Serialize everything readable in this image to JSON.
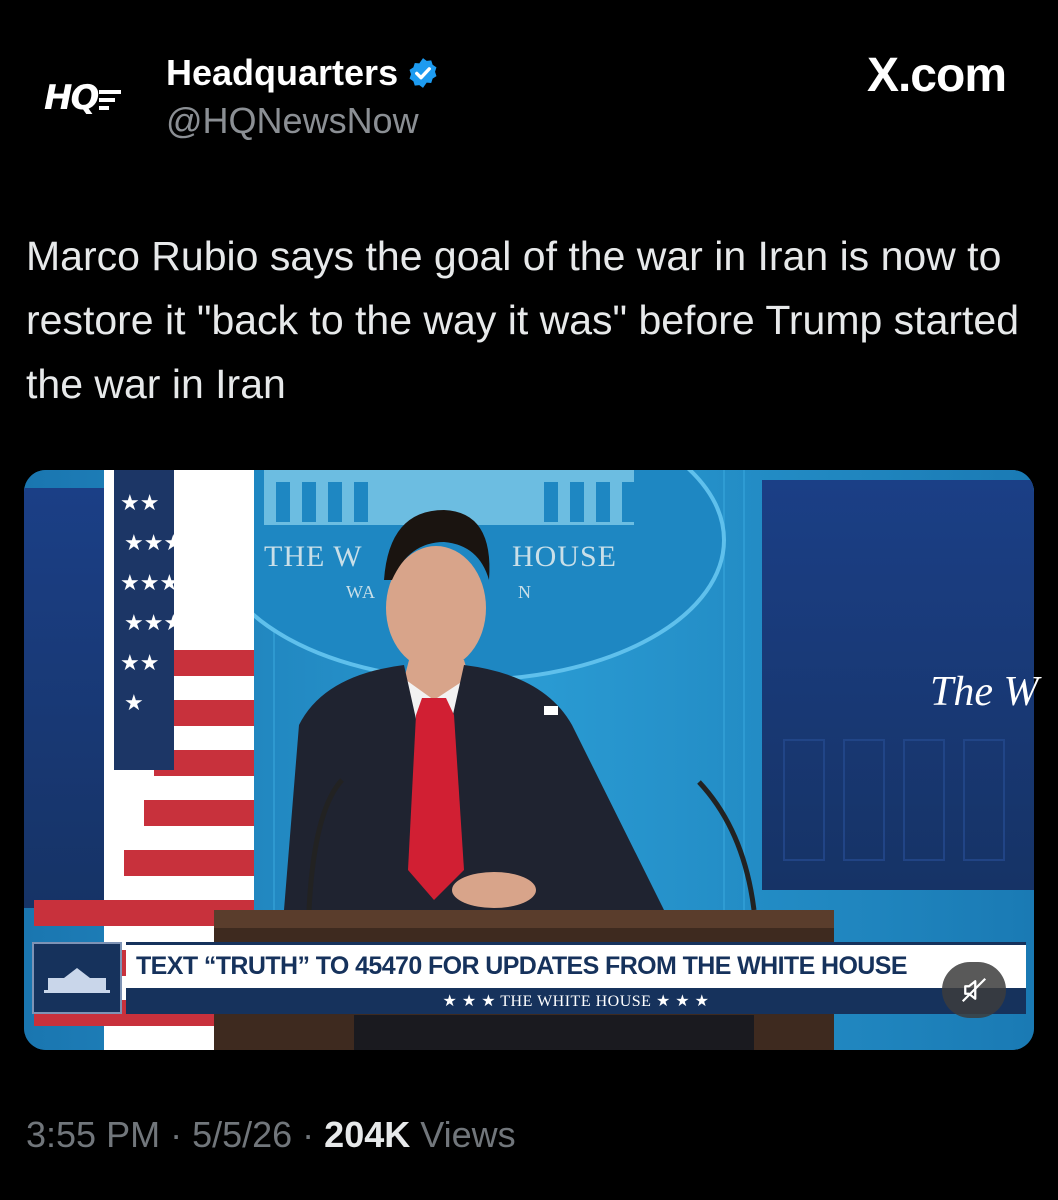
{
  "account": {
    "logo_text": "HQ",
    "display_name": "Headquarters",
    "handle": "@HQNewsNow",
    "verified": true
  },
  "watermark": "X.com",
  "tweet": {
    "text": "Marco Rubio says the goal of the war in Iran is now to restore it \"back to the way it was\" before Trump started the war in Iran"
  },
  "video": {
    "sign_top": "THE W",
    "sign_top_right": "HOUSE",
    "sign_sub_left": "WA",
    "sign_sub_right": "N",
    "screen_text": "The W",
    "chyron": "TEXT “TRUTH” TO 45470 FOR UPDATES FROM THE WHITE HOUSE",
    "chyron_sub": "★ ★ ★   THE WHITE HOUSE   ★ ★ ★",
    "mute_icon": "speaker-muted-icon"
  },
  "meta": {
    "time": "3:55 PM",
    "separator": " · ",
    "date": "5/5/26",
    "views_count": "204K",
    "views_label": " Views"
  },
  "colors": {
    "background": "#000000",
    "text": "#e7e9ea",
    "secondary": "#71767b",
    "verified": "#1d9bf0",
    "chyron_navy": "#16325c"
  }
}
